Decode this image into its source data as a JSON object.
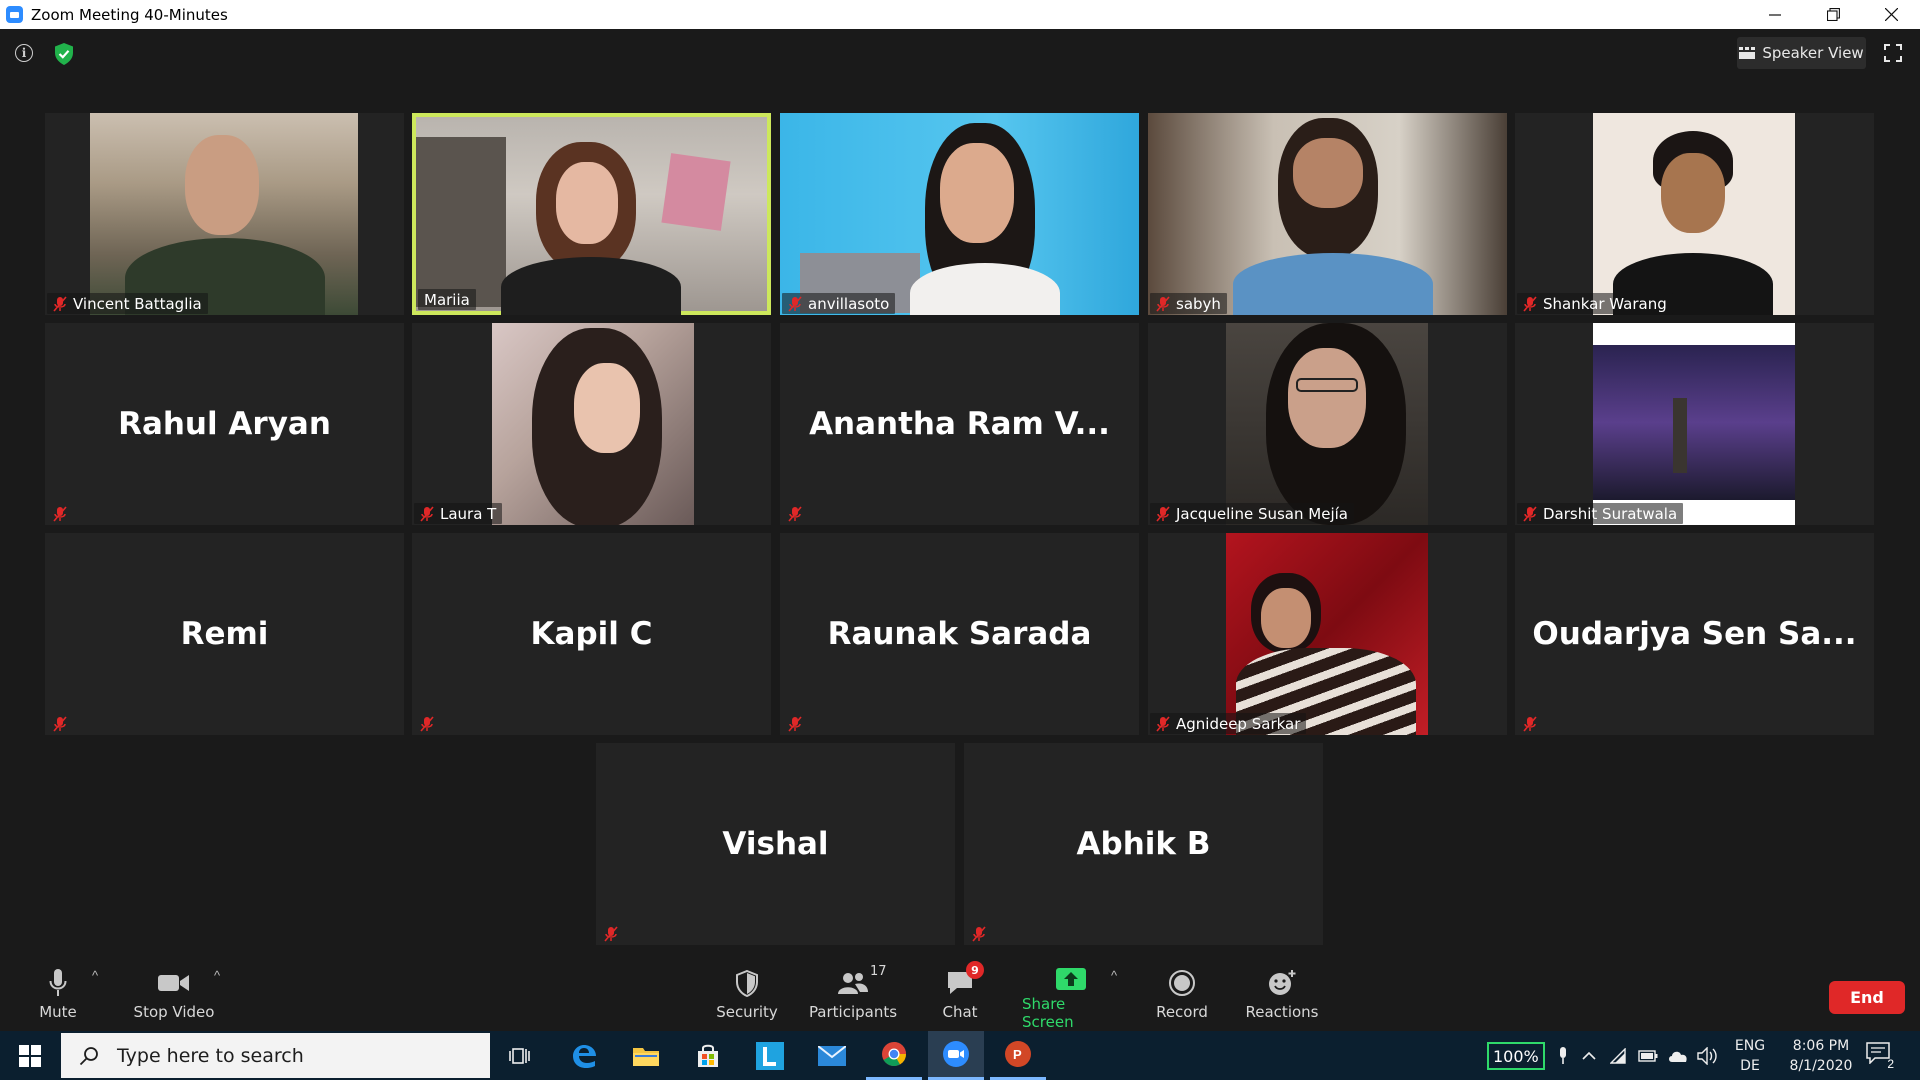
{
  "window": {
    "title": "Zoom Meeting 40-Minutes"
  },
  "topbar": {
    "speaker_view_label": "Speaker View"
  },
  "tiles": [
    {
      "name": "Vincent Battaglia",
      "has_video": true,
      "muted": true
    },
    {
      "name": "Mariia",
      "has_video": true,
      "muted": false,
      "active_speaker": true
    },
    {
      "name": "anvillasoto",
      "has_video": true,
      "muted": true
    },
    {
      "name": "sabyh",
      "has_video": true,
      "muted": true
    },
    {
      "name": "Shankar Warang",
      "has_video": true,
      "muted": true
    },
    {
      "name": "Rahul Aryan",
      "has_video": false,
      "muted": true
    },
    {
      "name": "Laura T",
      "has_video": true,
      "muted": true
    },
    {
      "name": "Anantha Ram V...",
      "has_video": false,
      "muted": true
    },
    {
      "name": "Jacqueline Susan Mejía",
      "has_video": true,
      "muted": true
    },
    {
      "name": "Darshit Suratwala",
      "has_video": true,
      "muted": true
    },
    {
      "name": "Remi",
      "has_video": false,
      "muted": true
    },
    {
      "name": "Kapil C",
      "has_video": false,
      "muted": true
    },
    {
      "name": "Raunak Sarada",
      "has_video": false,
      "muted": true
    },
    {
      "name": "Agnideep Sarkar",
      "has_video": true,
      "muted": true
    },
    {
      "name": "Oudarjya Sen Sa...",
      "has_video": false,
      "muted": true
    },
    {
      "name": "Vishal",
      "has_video": false,
      "muted": true
    },
    {
      "name": "Abhik B",
      "has_video": false,
      "muted": true
    }
  ],
  "toolbar": {
    "mute": "Mute",
    "stop_video": "Stop Video",
    "security": "Security",
    "participants": "Participants",
    "participants_count": "17",
    "chat": "Chat",
    "chat_unread": "9",
    "share_screen": "Share Screen",
    "record": "Record",
    "reactions": "Reactions",
    "end": "End"
  },
  "taskbar": {
    "search_placeholder": "Type here to search",
    "battery_percent": "100%",
    "lang_top": "ENG",
    "lang_bottom": "DE",
    "time": "8:06 PM",
    "date": "8/1/2020",
    "notification_count": "2"
  },
  "colors": {
    "active_speaker_border": "#cde85c",
    "share_screen_green": "#2fd96a",
    "end_red": "#e02828",
    "tile_bg": "#232323",
    "meeting_bg": "#1a1a1a"
  }
}
